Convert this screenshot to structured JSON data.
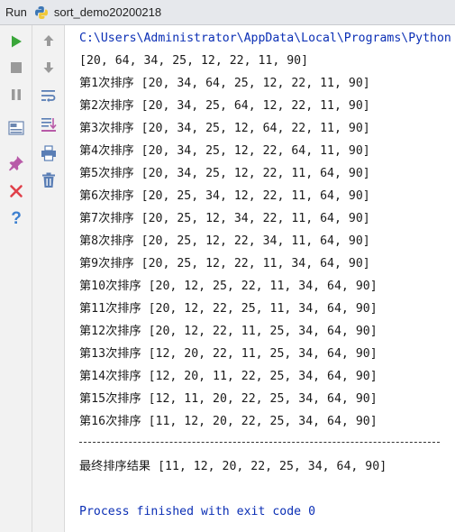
{
  "header": {
    "run_label": "Run",
    "config_name": "sort_demo20200218"
  },
  "left_toolbar": {
    "icons": [
      "rerun-icon",
      "stop-icon",
      "pause-icon",
      "layout-icon",
      "pin-icon",
      "close-icon",
      "help-icon"
    ]
  },
  "right_toolbar": {
    "icons": [
      "up-arrow-icon",
      "down-arrow-icon",
      "soft-wrap-icon",
      "scroll-to-end-icon",
      "print-icon",
      "trash-icon"
    ]
  },
  "console": {
    "command": "C:\\Users\\Administrator\\AppData\\Local\\Programs\\Python",
    "initial": "[20, 64, 34, 25, 12, 22, 11, 90]",
    "passes": [
      "第1次排序 [20, 34, 64, 25, 12, 22, 11, 90]",
      "第2次排序 [20, 34, 25, 64, 12, 22, 11, 90]",
      "第3次排序 [20, 34, 25, 12, 64, 22, 11, 90]",
      "第4次排序 [20, 34, 25, 12, 22, 64, 11, 90]",
      "第5次排序 [20, 34, 25, 12, 22, 11, 64, 90]",
      "第6次排序 [20, 25, 34, 12, 22, 11, 64, 90]",
      "第7次排序 [20, 25, 12, 34, 22, 11, 64, 90]",
      "第8次排序 [20, 25, 12, 22, 34, 11, 64, 90]",
      "第9次排序 [20, 25, 12, 22, 11, 34, 64, 90]",
      "第10次排序 [20, 12, 25, 22, 11, 34, 64, 90]",
      "第11次排序 [20, 12, 22, 25, 11, 34, 64, 90]",
      "第12次排序 [20, 12, 22, 11, 25, 34, 64, 90]",
      "第13次排序 [12, 20, 22, 11, 25, 34, 64, 90]",
      "第14次排序 [12, 20, 11, 22, 25, 34, 64, 90]",
      "第15次排序 [12, 11, 20, 22, 25, 34, 64, 90]",
      "第16次排序 [11, 12, 20, 22, 25, 34, 64, 90]"
    ],
    "separator": "--------------------------------------------------------",
    "result": "最终排序结果 [11, 12, 20, 22, 25, 34, 64, 90]",
    "exit_message": "Process finished with exit code 0"
  },
  "colors": {
    "output_text": "#1a1a1a",
    "system_text": "#0b2fb5",
    "run_green": "#3aa63a",
    "close_red": "#e0404a"
  }
}
